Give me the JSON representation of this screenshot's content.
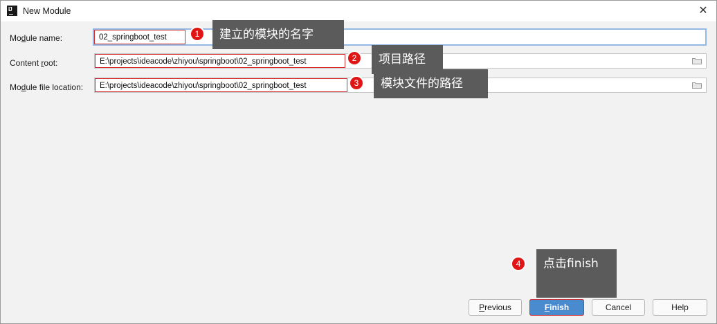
{
  "window": {
    "title": "New Module",
    "app_icon": "intellij-icon",
    "close_glyph": "✕"
  },
  "form": {
    "module_name": {
      "label": "Module name:",
      "value": "02_springboot_test"
    },
    "content_root": {
      "label": "Content root:",
      "value": "E:\\projects\\ideacode\\zhiyou\\springboot\\02_springboot_test"
    },
    "module_file_location": {
      "label": "Module file location:",
      "value": "E:\\projects\\ideacode\\zhiyou\\springboot\\02_springboot_test"
    }
  },
  "annotations": [
    {
      "number": "1",
      "text": "建立的模块的名字"
    },
    {
      "number": "2",
      "text": "项目路径"
    },
    {
      "number": "3",
      "text": "模块文件的路径"
    },
    {
      "number": "4",
      "text": "点击finish"
    }
  ],
  "buttons": {
    "previous": "Previous",
    "finish": "Finish",
    "cancel": "Cancel",
    "help": "Help"
  },
  "colors": {
    "accent": "#4a8bd0",
    "highlight_red": "#d23030",
    "callout_bg": "#5b5b5b",
    "focus": "#94b8e6"
  }
}
